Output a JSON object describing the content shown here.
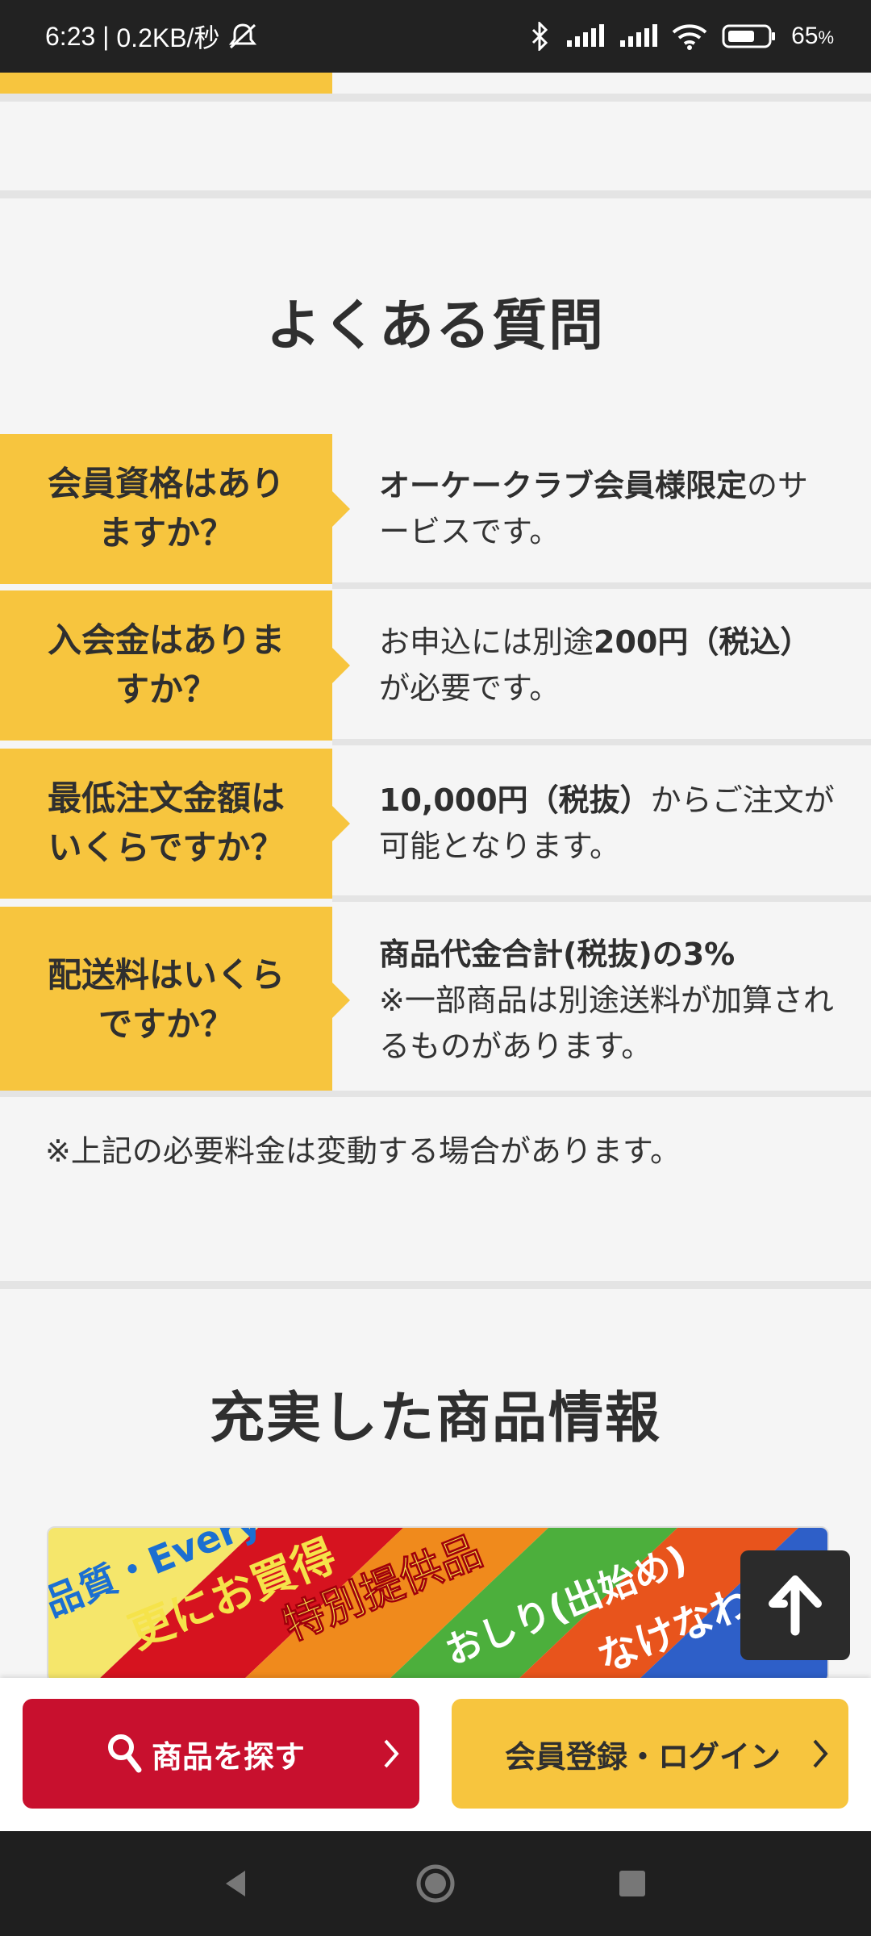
{
  "status_bar": {
    "time": "6:23",
    "network_speed": "0.2KB/秒",
    "battery_percent": "65",
    "battery_unit": "%",
    "icons": [
      "mute-icon",
      "bluetooth-icon",
      "signal-icon",
      "signal-icon",
      "wifi-icon",
      "battery-icon"
    ]
  },
  "faq": {
    "title": "よくある質問",
    "items": [
      {
        "question_line1": "会員資格はあり",
        "question_line2": "ますか？",
        "answer_bold": "オーケークラブ会員様限定",
        "answer_rest": "のサービスです。"
      },
      {
        "question_line1": "入会金はありま",
        "question_line2": "すか？",
        "answer_pre": "お申込には別途",
        "answer_bold": "200円（税込）",
        "answer_post": "が必要です。"
      },
      {
        "question_line1": "最低注文金額は",
        "question_line2": "いくらですか？",
        "answer_bold": "10,000円（税抜）",
        "answer_rest": "からご注文が可能となります。"
      },
      {
        "question_line1": "配送料はいくら",
        "question_line2": "ですか？",
        "answer_bold": "商品代金合計(税抜)の3%",
        "answer_rest": "※一部商品は別途送料が加算されるものがあります。"
      }
    ],
    "note": "※上記の必要料金は変動する場合があります。"
  },
  "products": {
    "title": "充実した商品情報",
    "banner_texts": [
      "品質・Every",
      "更にお買得",
      "特別提供品",
      "おしり(出始め)",
      "なけなわ"
    ]
  },
  "bottom_bar": {
    "search_label": "商品を探す",
    "member_label": "会員登録・ログイン"
  },
  "colors": {
    "accent_yellow": "#f7c53e",
    "accent_red": "#c8102e",
    "text_dark": "#2f2f2f"
  }
}
